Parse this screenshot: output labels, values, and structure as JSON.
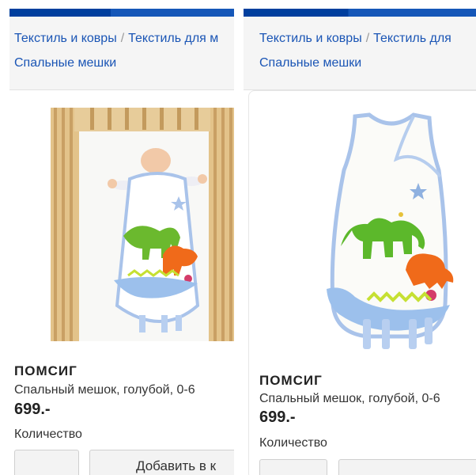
{
  "left": {
    "breadcrumb": [
      "Текстиль и ковры",
      "Текстиль для м"
    ],
    "breadcrumb_line2": "Спальные мешки",
    "product": {
      "name": "ПОМСИГ",
      "description": "Спальный мешок, голубой, 0-6",
      "price": "699.-"
    },
    "quantity_label": "Количество",
    "add_label": "Добавить в к"
  },
  "right": {
    "breadcrumb": [
      "Текстиль и ковры",
      "Текстиль для"
    ],
    "breadcrumb_line2": "Спальные мешки",
    "product": {
      "name": "ПОМСИГ",
      "description": "Спальный мешок, голубой, 0-6",
      "price": "699.-"
    },
    "quantity_label": "Количество"
  },
  "colors": {
    "brand_blue": "#003f9e",
    "link_blue": "#1a55b5",
    "bag_green": "#5cb82b",
    "bag_orange": "#f06a1a",
    "bag_blue": "#8fb1e0"
  }
}
